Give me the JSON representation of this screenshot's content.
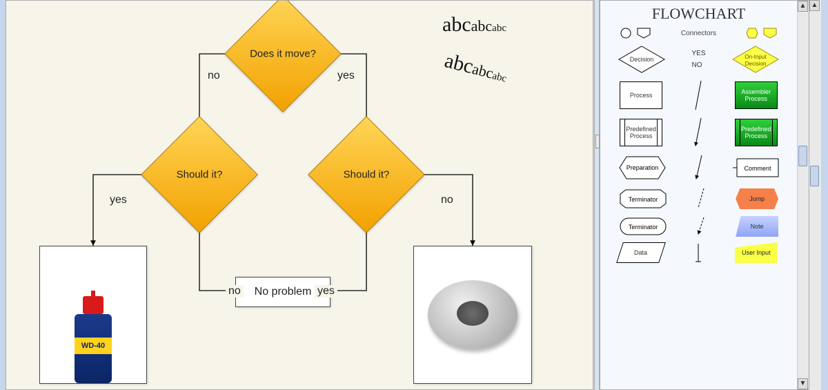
{
  "canvas": {
    "nodes": {
      "root": {
        "label": "Does it\nmove?"
      },
      "left": {
        "label": "Should it?"
      },
      "right": {
        "label": "Should it?"
      },
      "center": {
        "label": "No problem"
      },
      "wd40_label": "WD-40"
    },
    "edges": {
      "root_left": "no",
      "root_right": "yes",
      "left_out_l": "yes",
      "left_out_r": "no",
      "right_out_l": "yes",
      "right_out_r": "no"
    },
    "text_demo": {
      "line1": {
        "big": "abc",
        "mid": "abc",
        "small": "abc"
      },
      "line2": {
        "big": "abc",
        "mid": "abc",
        "small": "abc"
      }
    }
  },
  "palette": {
    "title": "FLOWCHART",
    "connectors_label": "Connectors",
    "decision": "Decision",
    "decision_yes": "YES",
    "decision_no": "NO",
    "oninput_decision": "On-Input\nDecision",
    "process": "Process",
    "assembler_process": "Assembler\nProcess",
    "predefined_process": "Predefined\nProcess",
    "predefined_process2": "Predefined\nProcess",
    "preparation": "Preparation",
    "comment": "Comment",
    "terminator": "Terminator",
    "jump": "Jump",
    "terminator2": "Terminator",
    "note": "Note",
    "data": "Data",
    "user_input": "User Input"
  }
}
